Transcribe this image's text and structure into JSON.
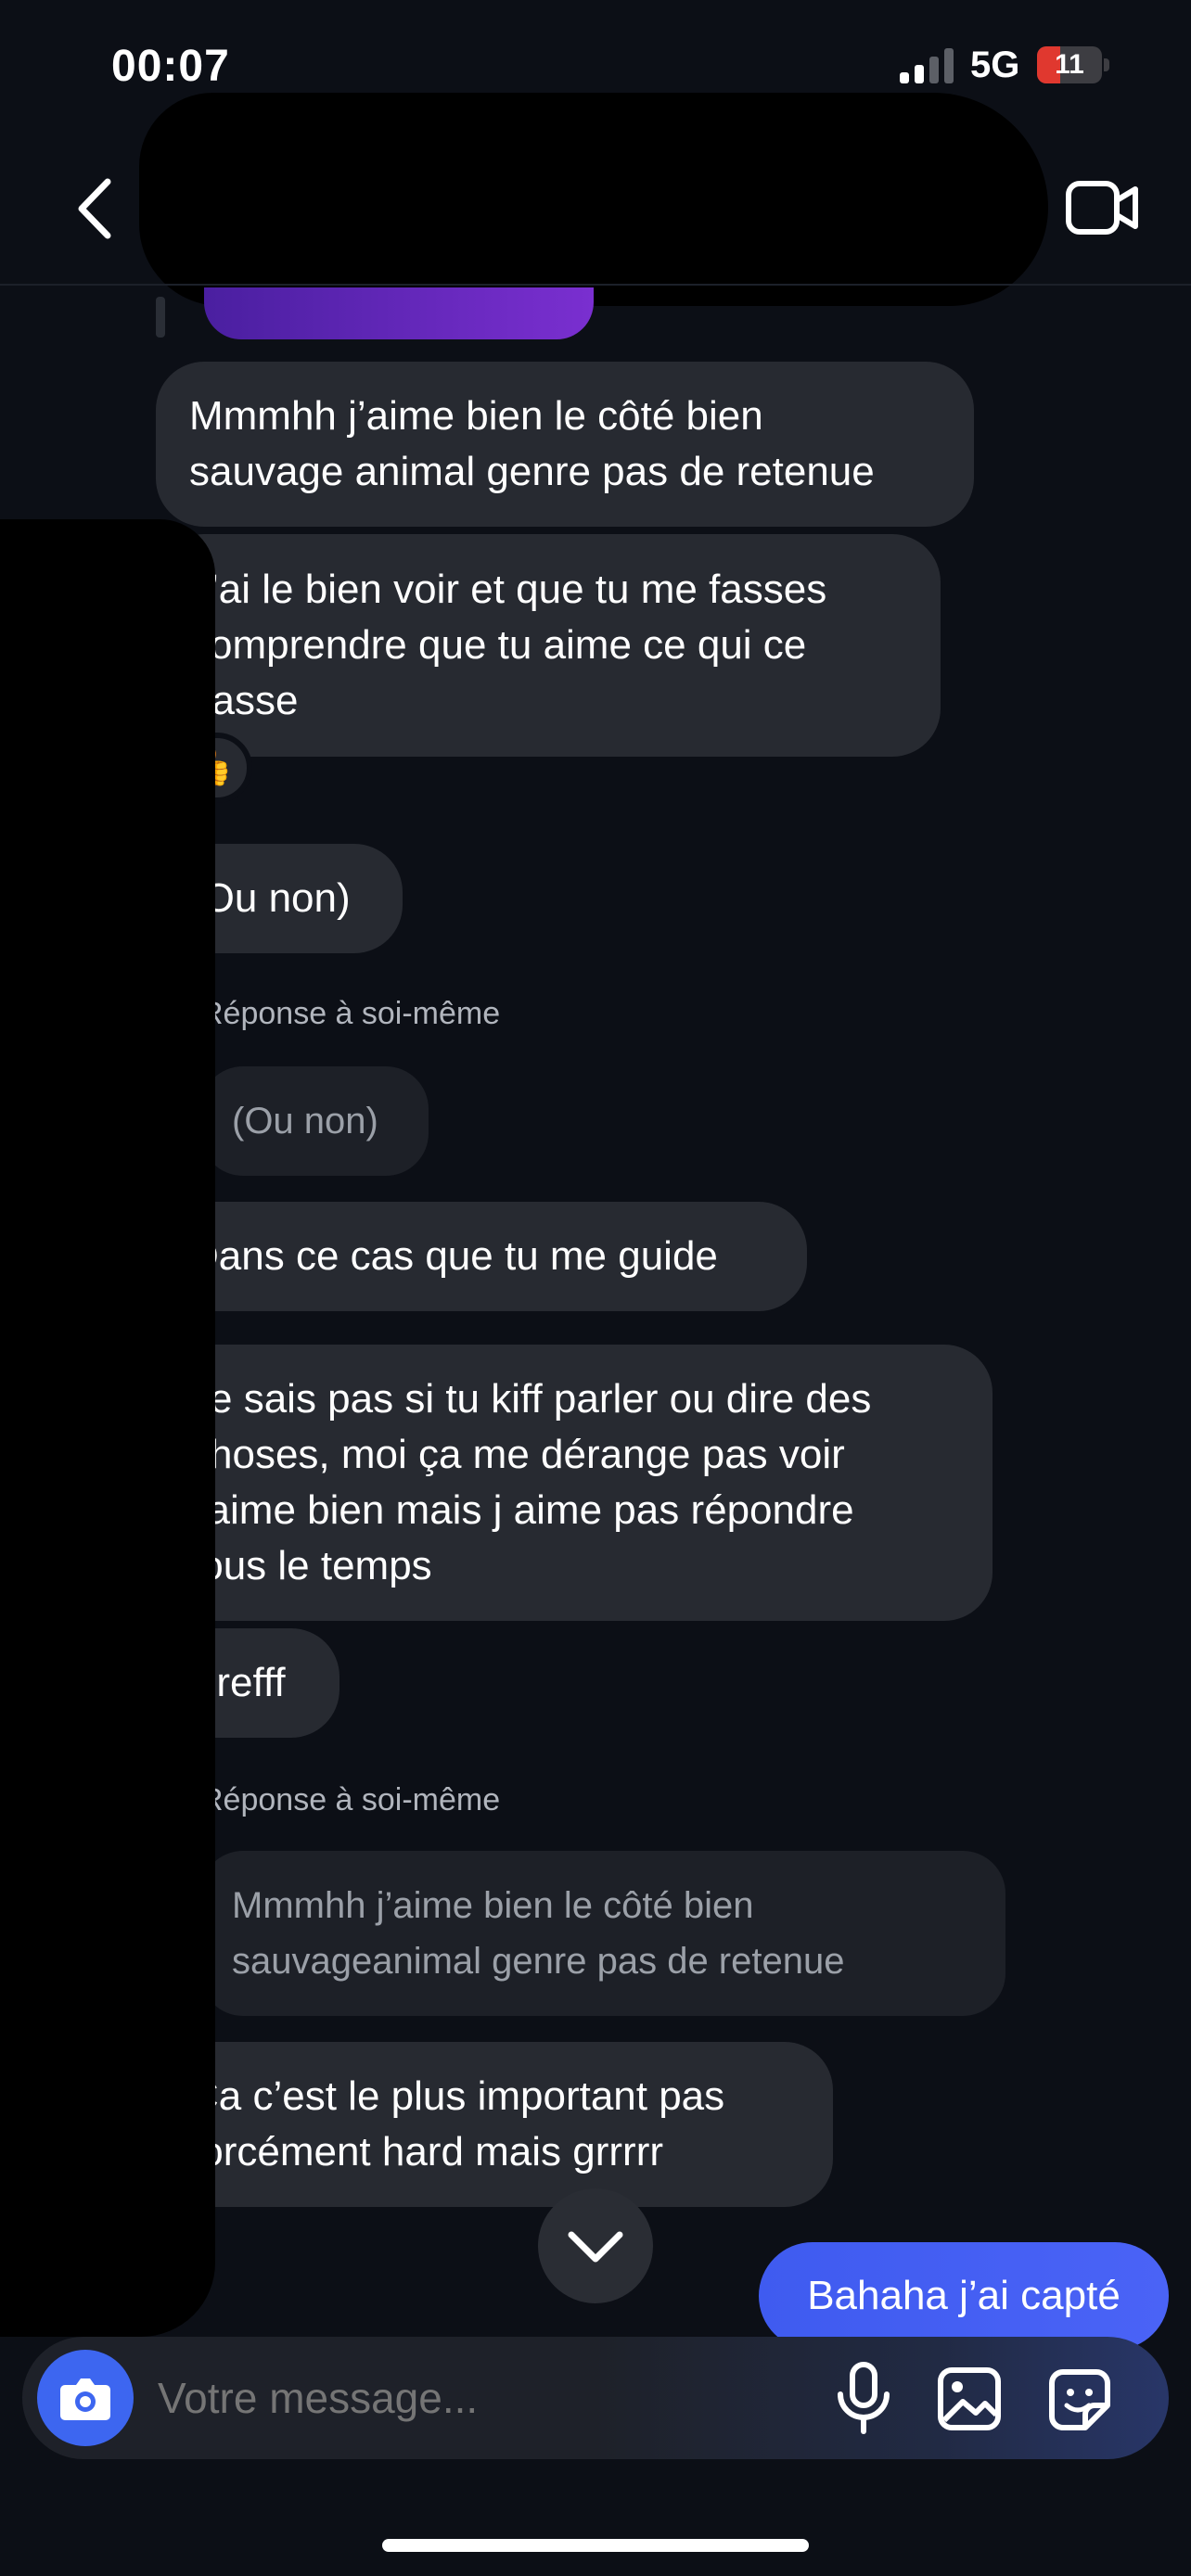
{
  "status_bar": {
    "time": "00:07",
    "network": "5G",
    "battery": "11",
    "battery_level": 0.11
  },
  "header": {
    "back_icon": "chevron-left-icon",
    "video_icon": "video-camera-icon"
  },
  "messages": [
    {
      "lines": [
        "Mmmhh j’aime bien le côté bien",
        "sauvage animal genre pas de retenue"
      ]
    },
    {
      "lines": [
        "J’ai le bien voir et que tu me fasses",
        "comprendre que tu aime ce qui ce",
        "passe"
      ],
      "reaction": "👍"
    },
    {
      "lines": [
        "(Ou non)"
      ]
    },
    {
      "reply_label": "Réponse à soi-même",
      "quoted": [
        "(Ou non)"
      ]
    },
    {
      "lines": [
        "Dans ce cas que tu me guide"
      ]
    },
    {
      "lines": [
        "Je sais pas si tu kiff parler ou dire des",
        "choses, moi ça me dérange pas voir",
        "j’aime bien mais j aime pas répondre",
        "tous le temps"
      ]
    },
    {
      "lines": [
        "Brefff"
      ]
    },
    {
      "reply_label": "Réponse à soi-même",
      "quoted": [
        "Mmmhh j’aime bien le côté bien sauvage",
        "animal genre pas de retenue"
      ]
    },
    {
      "lines": [
        "Ça c’est le plus important pas",
        "forcément hard mais grrrrr"
      ]
    }
  ],
  "outgoing": {
    "text": "Bahaha j’ai capté",
    "color": "#4360f3"
  },
  "composer": {
    "placeholder": "Votre message...",
    "camera_icon": "camera-icon",
    "mic_icon": "microphone-icon",
    "gallery_icon": "image-icon",
    "sticker_icon": "sticker-icon",
    "accent": "#3d66f0"
  },
  "scroll_down_icon": "chevron-down-icon"
}
